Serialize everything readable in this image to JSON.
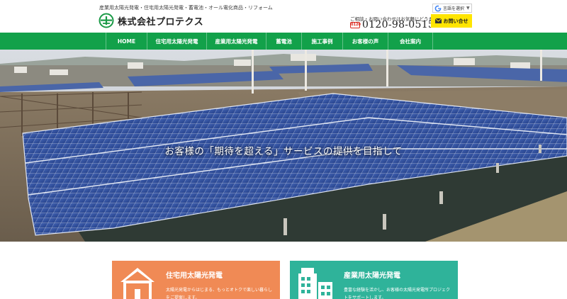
{
  "header": {
    "tagline": "産業用太陽光発電・住宅用太陽光発電・蓄電池・オール電化商品・リフォーム",
    "company_name": "株式会社プロテクス",
    "contact_note": "ご相談・お問い合わせはお気軽にどうぞ！",
    "freedial_label": "0120",
    "phone": "0120-98-0515",
    "language_select": "言語を選択",
    "inquiry_button": "お問い合せ"
  },
  "nav": {
    "items": [
      {
        "label": "HOME"
      },
      {
        "label": "住宅用太陽光発電"
      },
      {
        "label": "産業用太陽光発電"
      },
      {
        "label": "蓄電池"
      },
      {
        "label": "施工事例"
      },
      {
        "label": "お客様の声"
      },
      {
        "label": "会社案内"
      }
    ]
  },
  "hero": {
    "caption": "お客様の「期待を超える」サービスの提供を目指して"
  },
  "cards": [
    {
      "title": "住宅用太陽光発電",
      "text": "太陽光発電からはじまる、もっとオトクで楽しい暮らしをご提案します。",
      "icon": "house-icon",
      "color": "#f08a55"
    },
    {
      "title": "産業用太陽光発電",
      "text": "豊富な経験を活かし、お客様の太陽光発電所プロジェクトをサポートします。",
      "icon": "building-icon",
      "color": "#2fb39a"
    }
  ],
  "colors": {
    "nav_green": "#12a14a",
    "inquiry_yellow": "#ffe500",
    "residential_orange": "#f08a55",
    "industrial_teal": "#2fb39a"
  }
}
